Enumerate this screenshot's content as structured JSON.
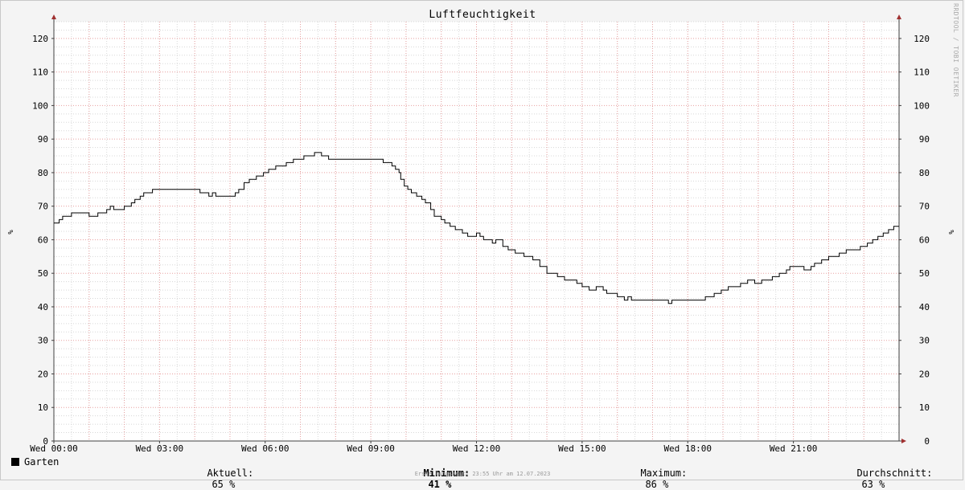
{
  "chart_data": {
    "type": "line",
    "title": "Luftfeuchtigkeit",
    "ylabel": "%",
    "ylim": [
      0,
      125
    ],
    "yticks": [
      0,
      10,
      20,
      30,
      40,
      50,
      60,
      70,
      80,
      90,
      100,
      110,
      120
    ],
    "x_tick_labels": [
      "Wed 00:00",
      "Wed 03:00",
      "Wed 06:00",
      "Wed 09:00",
      "Wed 12:00",
      "Wed 15:00",
      "Wed 18:00",
      "Wed 21:00"
    ],
    "x_tick_hours": [
      0,
      3,
      6,
      9,
      12,
      15,
      18,
      21
    ],
    "xlim_hours": [
      0,
      24
    ],
    "grid": true,
    "series": [
      {
        "name": "Garten",
        "color": "#000000",
        "x_hours": [
          0.0,
          0.15,
          0.25,
          0.35,
          0.5,
          1.0,
          1.2,
          1.25,
          1.5,
          1.6,
          1.7,
          1.8,
          2.0,
          2.2,
          2.3,
          2.45,
          2.55,
          2.65,
          2.8,
          2.9,
          3.5,
          4.0,
          4.15,
          4.4,
          4.5,
          4.6,
          4.75,
          5.0,
          5.15,
          5.25,
          5.4,
          5.55,
          5.75,
          5.95,
          6.1,
          6.3,
          6.6,
          6.8,
          7.1,
          7.4,
          7.6,
          7.8,
          9.2,
          9.35,
          9.6,
          9.7,
          9.8,
          9.85,
          9.95,
          10.05,
          10.15,
          10.3,
          10.45,
          10.55,
          10.7,
          10.8,
          11.0,
          11.1,
          11.25,
          11.4,
          11.6,
          11.75,
          11.85,
          12.0,
          12.1,
          12.2,
          12.3,
          12.45,
          12.55,
          12.75,
          12.9,
          13.1,
          13.35,
          13.6,
          13.8,
          14.0,
          14.3,
          14.5,
          14.65,
          14.85,
          15.0,
          15.2,
          15.4,
          15.6,
          15.7,
          16.0,
          16.2,
          16.3,
          16.4,
          16.6,
          17.0,
          17.45,
          17.55,
          18.0,
          18.4,
          18.5,
          18.6,
          18.75,
          18.95,
          19.15,
          19.5,
          19.7,
          19.9,
          20.1,
          20.4,
          20.6,
          20.8,
          20.9,
          21.1,
          21.3,
          21.5,
          21.6,
          21.8,
          22.0,
          22.3,
          22.5,
          22.7,
          22.9,
          23.1,
          23.25,
          23.4,
          23.55,
          23.7,
          23.85
        ],
        "values": [
          65,
          66,
          67,
          67,
          68,
          67,
          67,
          68,
          69,
          70,
          69,
          69,
          70,
          71,
          72,
          73,
          74,
          74,
          75,
          75,
          75,
          75,
          74,
          73,
          74,
          73,
          73,
          73,
          74,
          75,
          77,
          78,
          79,
          80,
          81,
          82,
          83,
          84,
          85,
          86,
          85,
          84,
          84,
          83,
          82,
          81,
          80,
          78,
          76,
          75,
          74,
          73,
          72,
          71,
          69,
          67,
          66,
          65,
          64,
          63,
          62,
          61,
          61,
          62,
          61,
          60,
          60,
          59,
          60,
          58,
          57,
          56,
          55,
          54,
          52,
          50,
          49,
          48,
          48,
          47,
          46,
          45,
          46,
          45,
          44,
          43,
          42,
          43,
          42,
          42,
          42,
          41,
          42,
          42,
          42,
          43,
          43,
          44,
          45,
          46,
          47,
          48,
          47,
          48,
          49,
          50,
          51,
          52,
          52,
          51,
          52,
          53,
          54,
          55,
          56,
          57,
          57,
          58,
          59,
          60,
          61,
          62,
          63,
          64
        ]
      }
    ]
  },
  "legend": {
    "series_name": "Garten",
    "current_label": "Aktuell:",
    "current_value": "65 %",
    "minimum_label": "Minimum:",
    "minimum_value": "41 %",
    "maximum_label": "Maximum:",
    "maximum_value": "86 %",
    "average_label": "Durchschnitt:",
    "average_value": "63 %"
  },
  "watermark": "RRDTOOL / TOBI OETIKER",
  "footer": "Erstellungszeit: 23:55 Uhr am 12.07.2023",
  "colors": {
    "background": "#f4f4f4",
    "plot_background": "#ffffff",
    "minor_grid": "#d8d8d8",
    "major_grid": "#e8a0a0",
    "axis": "#404040",
    "arrow": "#a03030",
    "line": "#000000"
  }
}
